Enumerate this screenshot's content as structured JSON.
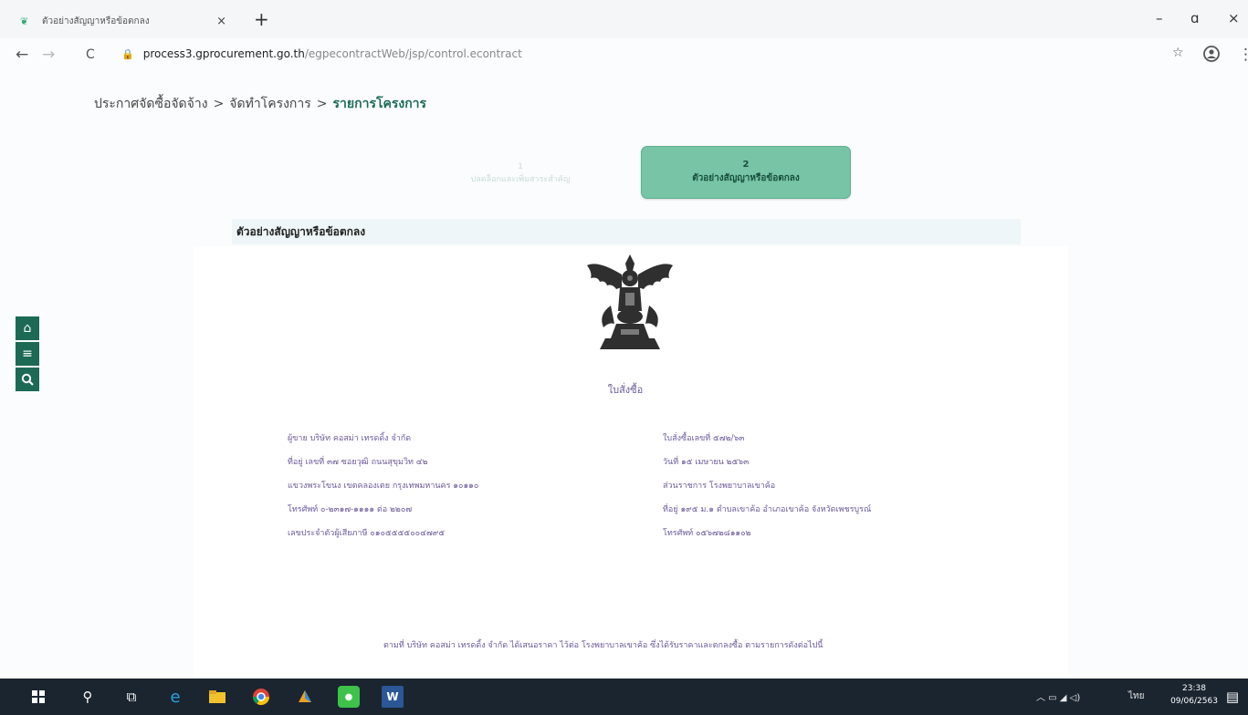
{
  "browser": {
    "tab_title": "ตัวอย่างสัญญาหรือข้อตกลง",
    "tab_close": "×",
    "new_tab": "+",
    "url_host": "process3.gprocurement.go.th",
    "url_path": "/egpecontractWeb/jsp/control.econtract",
    "back": "←",
    "forward": "→",
    "reload": "C",
    "minimize": "–",
    "maximize": "ɑ",
    "close": "×",
    "star": "☆",
    "more": "⋮"
  },
  "breadcrumb": {
    "item1": "ประกาศจัดซื้อจัดจ้าง",
    "sep": ">",
    "item2": "จัดทำโครงการ",
    "current": "รายการโครงการ"
  },
  "steps": [
    {
      "number": "1",
      "label": "ปลดล็อกและเพิ่มสาระสำคัญ"
    },
    {
      "number": "2",
      "label": "ตัวอย่างสัญญาหรือข้อตกลง"
    }
  ],
  "section_title": "ตัวอย่างสัญญาหรือข้อตกลง",
  "document": {
    "title": "ใบสั่งซื้อ",
    "left_lines": [
      "ผู้ขาย  บริษัท คอสม่า เทรดดิ้ง จำกัด",
      "ที่อยู่  เลขที่ ๓๗ ซอยวุฒิ ถนนสุขุมวิท ๔๒",
      "แขวงพระโขนง เขตคลองเตย กรุงเทพมหานคร ๑๐๑๑๐",
      "โทรศัพท์  ๐-๒๓๑๗-๑๑๑๑ ต่อ ๒๒๐๗",
      "เลขประจำตัวผู้เสียภาษี  ๐๑๐๕๕๕๕๐๐๔๗๙๕"
    ],
    "right_lines": [
      "ใบสั่งซื้อเลขที่  ๕๗๒/๖๓",
      "วันที่  ๑๕ เมษายน ๒๕๖๓",
      "ส่วนราชการ  โรงพยาบาลเขาค้อ",
      "ที่อยู่  ๑๙๕ ม.๑ ตำบลเขาค้อ อำเภอเขาค้อ จังหวัดเพชรบูรณ์",
      "โทรศัพท์  ๐๕๖๗๒๘๑๑๐๒"
    ],
    "footer": "ตามที่ บริษัท คอสม่า เทรดดิ้ง จำกัด ได้เสนอราคา ไว้ต่อ โรงพยาบาลเขาค้อ ซึ่งได้รับราคาและตกลงซื้อ ตามรายการดังต่อไปนี้"
  },
  "side_buttons": [
    {
      "icon": "home-icon",
      "glyph": "⌂"
    },
    {
      "icon": "menu-icon",
      "glyph": "≡"
    },
    {
      "icon": "search-icon",
      "glyph": "⚲"
    }
  ],
  "taskbar": {
    "lang": "ไทย",
    "time": "23:38",
    "date": "09/06/2563"
  },
  "colors": {
    "accent": "#77c4a6",
    "sidebar_button": "#1c6a55",
    "document_text": "#6a5a9a"
  }
}
